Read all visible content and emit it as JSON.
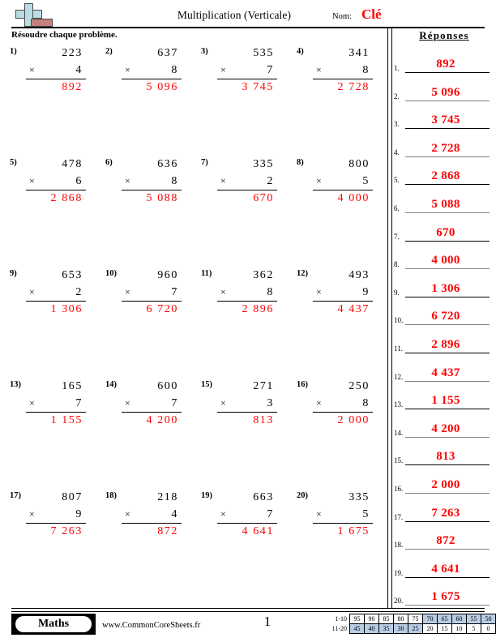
{
  "header": {
    "title": "Multiplication (Verticale)",
    "name_label": "Nom:",
    "name_value": "Clé",
    "instruction": "Résoudre chaque problème.",
    "answers_heading": "Réponses",
    "logo_icon": "plus-block-logo",
    "name_value_color": "#ff0000"
  },
  "problems": [
    {
      "num": "1)",
      "top": "223",
      "op": "×",
      "bottom": "4",
      "answer": "892"
    },
    {
      "num": "2)",
      "top": "637",
      "op": "×",
      "bottom": "8",
      "answer": "5 096"
    },
    {
      "num": "3)",
      "top": "535",
      "op": "×",
      "bottom": "7",
      "answer": "3 745"
    },
    {
      "num": "4)",
      "top": "341",
      "op": "×",
      "bottom": "8",
      "answer": "2 728"
    },
    {
      "num": "5)",
      "top": "478",
      "op": "×",
      "bottom": "6",
      "answer": "2 868"
    },
    {
      "num": "6)",
      "top": "636",
      "op": "×",
      "bottom": "8",
      "answer": "5 088"
    },
    {
      "num": "7)",
      "top": "335",
      "op": "×",
      "bottom": "2",
      "answer": "670"
    },
    {
      "num": "8)",
      "top": "800",
      "op": "×",
      "bottom": "5",
      "answer": "4 000"
    },
    {
      "num": "9)",
      "top": "653",
      "op": "×",
      "bottom": "2",
      "answer": "1 306"
    },
    {
      "num": "10)",
      "top": "960",
      "op": "×",
      "bottom": "7",
      "answer": "6 720"
    },
    {
      "num": "11)",
      "top": "362",
      "op": "×",
      "bottom": "8",
      "answer": "2 896"
    },
    {
      "num": "12)",
      "top": "493",
      "op": "×",
      "bottom": "9",
      "answer": "4 437"
    },
    {
      "num": "13)",
      "top": "165",
      "op": "×",
      "bottom": "7",
      "answer": "1 155"
    },
    {
      "num": "14)",
      "top": "600",
      "op": "×",
      "bottom": "7",
      "answer": "4 200"
    },
    {
      "num": "15)",
      "top": "271",
      "op": "×",
      "bottom": "3",
      "answer": "813"
    },
    {
      "num": "16)",
      "top": "250",
      "op": "×",
      "bottom": "8",
      "answer": "2 000"
    },
    {
      "num": "17)",
      "top": "807",
      "op": "×",
      "bottom": "9",
      "answer": "7 263"
    },
    {
      "num": "18)",
      "top": "218",
      "op": "×",
      "bottom": "4",
      "answer": "872"
    },
    {
      "num": "19)",
      "top": "663",
      "op": "×",
      "bottom": "7",
      "answer": "4 641"
    },
    {
      "num": "20)",
      "top": "335",
      "op": "×",
      "bottom": "5",
      "answer": "1 675"
    }
  ],
  "answer_key": [
    {
      "idx": "1.",
      "value": "892"
    },
    {
      "idx": "2.",
      "value": "5 096"
    },
    {
      "idx": "3.",
      "value": "3 745"
    },
    {
      "idx": "4.",
      "value": "2 728"
    },
    {
      "idx": "5.",
      "value": "2 868"
    },
    {
      "idx": "6.",
      "value": "5 088"
    },
    {
      "idx": "7.",
      "value": "670"
    },
    {
      "idx": "8.",
      "value": "4 000"
    },
    {
      "idx": "9.",
      "value": "1 306"
    },
    {
      "idx": "10.",
      "value": "6 720"
    },
    {
      "idx": "11.",
      "value": "2 896"
    },
    {
      "idx": "12.",
      "value": "4 437"
    },
    {
      "idx": "13.",
      "value": "1 155"
    },
    {
      "idx": "14.",
      "value": "4 200"
    },
    {
      "idx": "15.",
      "value": "813"
    },
    {
      "idx": "16.",
      "value": "2 000"
    },
    {
      "idx": "17.",
      "value": "7 263"
    },
    {
      "idx": "18.",
      "value": "872"
    },
    {
      "idx": "19.",
      "value": "4 641"
    },
    {
      "idx": "20.",
      "value": "1 675"
    }
  ],
  "footer": {
    "brand": "Maths",
    "url": "www.CommonCoreSheets.fr",
    "page_number": "1",
    "grading": {
      "row1_label": "1-10",
      "row2_label": "11-20",
      "row1": [
        {
          "v": "95",
          "hl": false
        },
        {
          "v": "90",
          "hl": false
        },
        {
          "v": "85",
          "hl": false
        },
        {
          "v": "80",
          "hl": false
        },
        {
          "v": "75",
          "hl": false
        },
        {
          "v": "70",
          "hl": true
        },
        {
          "v": "65",
          "hl": true
        },
        {
          "v": "60",
          "hl": true
        },
        {
          "v": "55",
          "hl": true
        },
        {
          "v": "50",
          "hl": true
        }
      ],
      "row2": [
        {
          "v": "45",
          "hl": true
        },
        {
          "v": "40",
          "hl": true
        },
        {
          "v": "35",
          "hl": true
        },
        {
          "v": "30",
          "hl": true
        },
        {
          "v": "25",
          "hl": true
        },
        {
          "v": "20",
          "hl": false
        },
        {
          "v": "15",
          "hl": false
        },
        {
          "v": "10",
          "hl": false
        },
        {
          "v": "5",
          "hl": false
        },
        {
          "v": "0",
          "hl": false
        }
      ],
      "highlight_color": "#b8cce4"
    }
  }
}
